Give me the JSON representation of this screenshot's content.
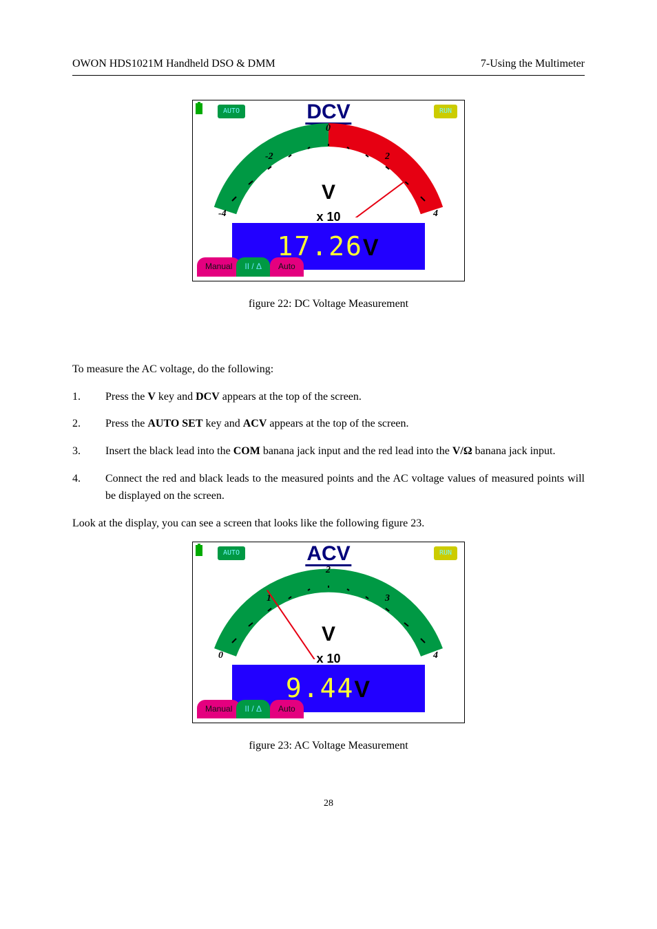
{
  "header": {
    "left": "OWON    HDS1021M Handheld DSO & DMM",
    "right": "7-Using the Multimeter"
  },
  "fig1": {
    "tags": {
      "auto": "AUTO",
      "run": "RUN"
    },
    "mode": "DCV",
    "scale": {
      "left": "-4",
      "mid_left": "-2",
      "center": "0",
      "mid_right": "2",
      "right": "4"
    },
    "unit": "V",
    "multiplier": "x 10",
    "readout_value": "17.26",
    "readout_unit": "V",
    "tabs": {
      "t1": "Manual",
      "t2": "II / Δ",
      "t3": "Auto"
    },
    "needle_ratio": 0.91,
    "arc": {
      "green_start": -4,
      "green_end": 0,
      "red_start": 0,
      "red_end": 4
    },
    "caption": "figure 22: DC Voltage Measurement"
  },
  "para1": "To measure the AC voltage, do the following:",
  "steps": [
    {
      "n": "1.",
      "t_pre": "Press the ",
      "b1": "V",
      "t_mid": " key and ",
      "b2": "DCV",
      "t_post": " appears at the top of the screen."
    },
    {
      "n": "2.",
      "t_pre": "Press the ",
      "b1": "AUTO SET",
      "t_mid": " key and ",
      "b2": "ACV",
      "t_post": " appears at the top of the screen."
    },
    {
      "n": "3.",
      "t_pre": "Insert the black lead into the ",
      "b1": "COM",
      "t_mid": " banana jack input and the red lead into the ",
      "b2": "V/Ω",
      "t_post": "  banana jack input."
    },
    {
      "n": "4.",
      "t_pre": "Connect the red and black leads to the measured points and the AC voltage values of measured points will be displayed on the screen.",
      "b1": "",
      "t_mid": "",
      "b2": "",
      "t_post": ""
    }
  ],
  "para2": "Look at the display, you can see a screen that looks like the following figure 23.",
  "fig2": {
    "tags": {
      "auto": "AUTO",
      "run": "RUN"
    },
    "mode": "ACV",
    "scale": {
      "left": "0",
      "mid_left": "1",
      "center": "2",
      "mid_right": "3",
      "right": "4"
    },
    "unit": "V",
    "multiplier": "x 10",
    "readout_value": "9.44",
    "readout_unit": "V",
    "tabs": {
      "t1": "Manual",
      "t2": "II / Δ",
      "t3": "Auto"
    },
    "needle_ratio": 0.236,
    "arc": {
      "green_start": 0,
      "green_end": 4,
      "red_start": 4,
      "red_end": 4
    },
    "caption": "figure 23: AC Voltage Measurement"
  },
  "page_number": "28",
  "chart_data": [
    {
      "type": "gauge",
      "title": "DCV",
      "min": -4,
      "max": 4,
      "zones": [
        {
          "from": -4,
          "to": 0,
          "color": "green"
        },
        {
          "from": 0,
          "to": 4,
          "color": "red"
        }
      ],
      "multiplier": 10,
      "reading": 17.26,
      "unit": "V",
      "needle_value": 1.726
    },
    {
      "type": "gauge",
      "title": "ACV",
      "min": 0,
      "max": 4,
      "zones": [
        {
          "from": 0,
          "to": 4,
          "color": "green"
        }
      ],
      "multiplier": 10,
      "reading": 9.44,
      "unit": "V",
      "needle_value": 0.944
    }
  ]
}
